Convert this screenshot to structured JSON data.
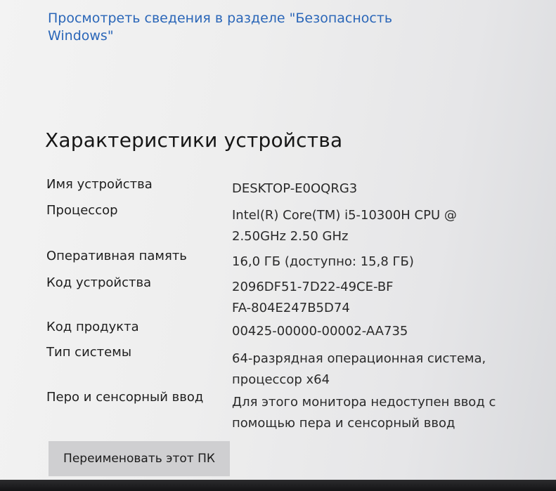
{
  "security_link": "Просмотреть сведения в разделе \"Безопасность Windows\"",
  "section_title": "Характеристики устройства",
  "specs": [
    {
      "label": "Имя устройства",
      "value": "DESKTOP-E0OQRG3"
    },
    {
      "label": "Процессор",
      "value": "Intel(R) Core(TM) i5-10300H CPU @ 2.50GHz   2.50 GHz"
    },
    {
      "label": "Оперативная память",
      "value": "16,0 ГБ (доступно: 15,8 ГБ)"
    },
    {
      "label": "Код устройства",
      "value": "2096DF51-7D22-49CE-BFFA-804E247B5D74"
    },
    {
      "label": "Код продукта",
      "value": "00425-00000-00002-AA735"
    },
    {
      "label": "Тип системы",
      "value": "64-разрядная операционная система, процессор x64"
    },
    {
      "label": "Перо и сенсорный ввод",
      "value": "Для этого монитора недоступен ввод с помощью пера и сенсорный ввод"
    }
  ],
  "rename_button": "Переименовать этот ПК"
}
